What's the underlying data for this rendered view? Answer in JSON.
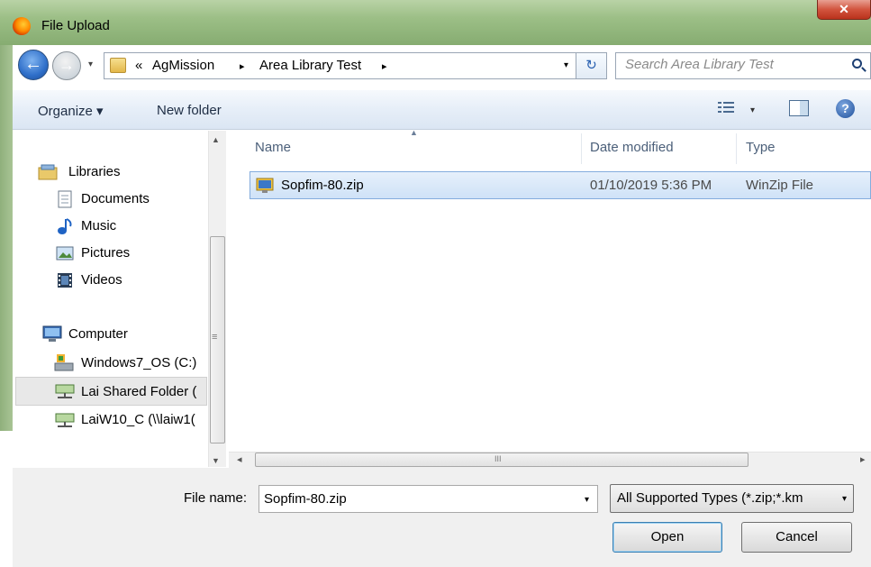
{
  "window": {
    "title": "File Upload",
    "close_glyph": "✕",
    "app_icon": "firefox-icon"
  },
  "nav_buttons": {
    "back_glyph": "←",
    "forward_glyph": "→",
    "dropdown_glyph": "▾"
  },
  "address_bar": {
    "overflow": "«",
    "crumbs": [
      "AgMission",
      "Area Library Test"
    ],
    "separator": "▸",
    "dropdown_glyph": "▾",
    "refresh_glyph": "↻"
  },
  "search": {
    "placeholder": "Search Area Library Test"
  },
  "toolbar": {
    "organize_label": "Organize ▾",
    "new_folder_label": "New folder",
    "view_dropdown": "▾",
    "help_glyph": "?"
  },
  "navigation": {
    "libraries": "Libraries",
    "library_items": [
      "Documents",
      "Music",
      "Pictures",
      "Videos"
    ],
    "computer": "Computer",
    "drives": [
      "Windows7_OS (C:)",
      "Lai Shared Folder (",
      "LaiW10_C (\\\\laiw1("
    ],
    "selected": "Lai Shared Folder ("
  },
  "columns": {
    "name": "Name",
    "date_modified": "Date modified",
    "type": "Type"
  },
  "files": [
    {
      "name": "Sopfim-80.zip",
      "date_modified": "01/10/2019 5:36 PM",
      "type": "WinZip File",
      "selected": true
    }
  ],
  "scrollbars": {
    "up": "▲",
    "down": "▼",
    "left": "◂",
    "right": "▸",
    "grip": "≡",
    "hgrip": "III"
  },
  "bottom": {
    "file_name_label": "File name:",
    "file_name_value": "Sopfim-80.zip",
    "file_type": "All Supported Types (*.zip;*.km",
    "dropdown_glyph": "▾",
    "open_label": "Open",
    "cancel_label": "Cancel"
  },
  "colors": {
    "title_bar": "#9cbf86",
    "selection": "#cfe2f7",
    "selection_border": "#84acdd",
    "close_button": "#d2543e"
  }
}
